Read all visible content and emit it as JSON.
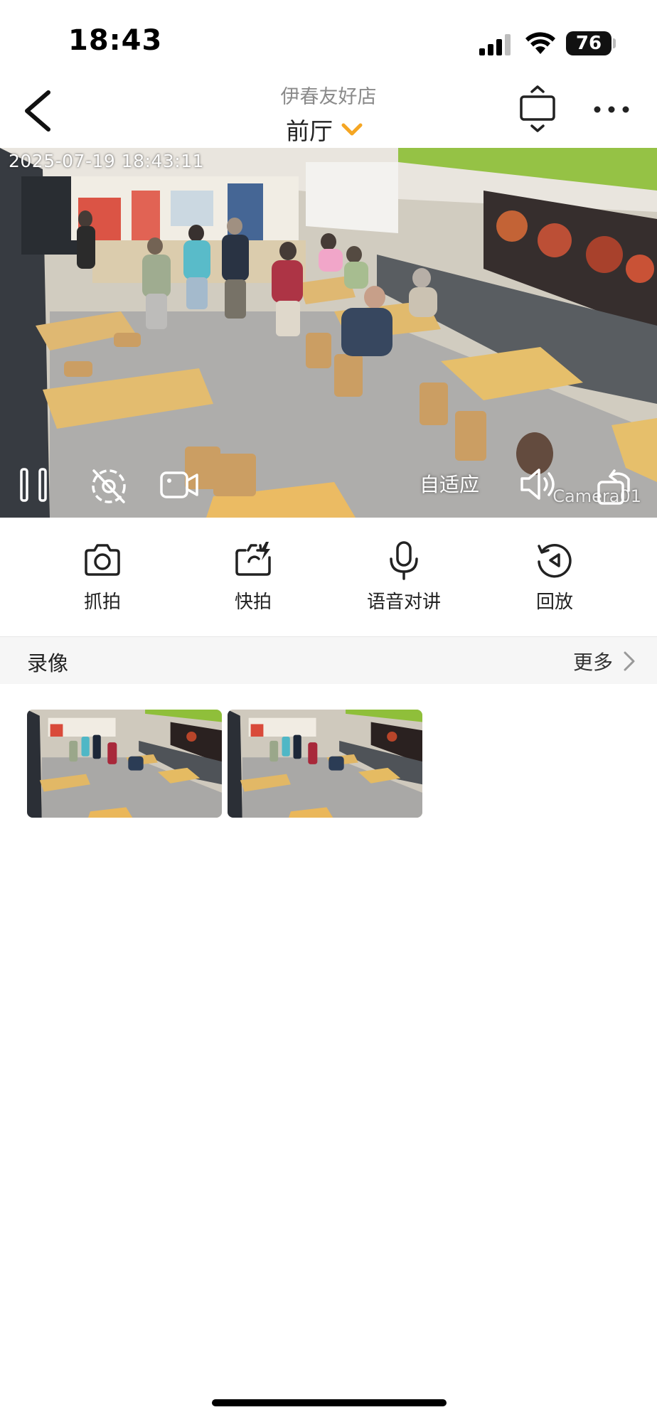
{
  "status_bar": {
    "time": "18:43",
    "battery": "76"
  },
  "header": {
    "store_name": "伊春友好店",
    "camera_name": "前厅",
    "accent_color": "#f5a623"
  },
  "video": {
    "timestamp": "2025-07-19 18:43:11",
    "camera_label": "Camera01",
    "adaptive_label": "自适应"
  },
  "actions": [
    {
      "label": "抓拍",
      "icon": "camera-icon"
    },
    {
      "label": "快拍",
      "icon": "quick-capture-icon"
    },
    {
      "label": "语音对讲",
      "icon": "microphone-icon"
    },
    {
      "label": "回放",
      "icon": "playback-icon"
    }
  ],
  "recordings": {
    "title": "录像",
    "more_label": "更多"
  }
}
